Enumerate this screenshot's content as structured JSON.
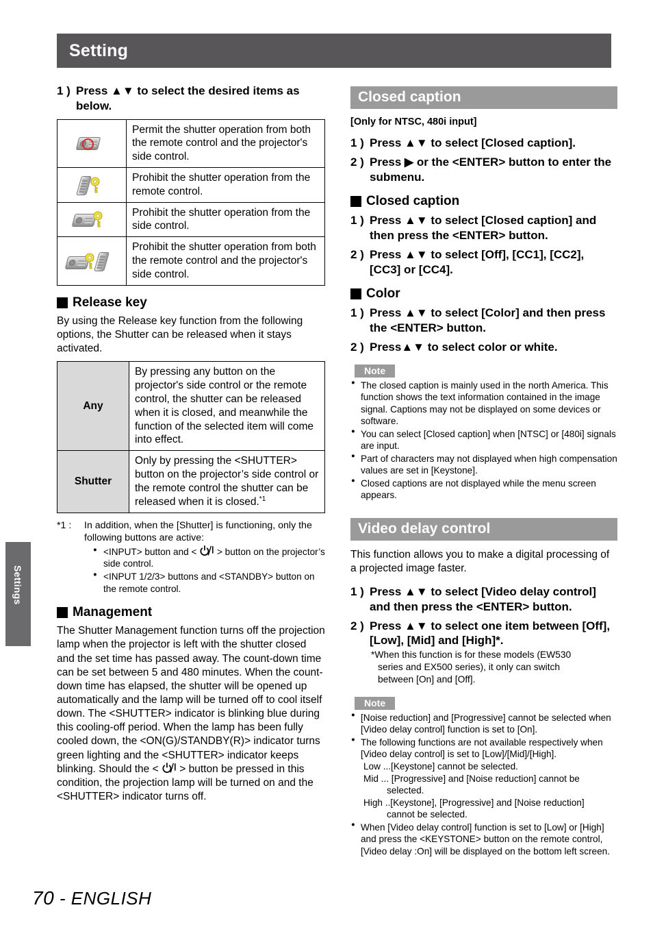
{
  "page": {
    "header_title": "Setting",
    "side_tab": "Settings",
    "footer_page": "70",
    "footer_sep": " - ",
    "footer_lang": "ENGLISH",
    "colors": {
      "header_bar": "#595659",
      "section_bar": "#9b9a9b",
      "side_tab": "#6b6a6c",
      "table_label_fill": "#d9d9d9",
      "icon_red": "#e2231a",
      "icon_yellow": "#f2e33c"
    }
  },
  "left": {
    "step1": {
      "num": "1 )",
      "text": "Press ▲▼ to select the desired items as below."
    },
    "icon_table": [
      {
        "icon": "projector-permit-icon",
        "desc": "Permit the shutter operation from both the remote control and the projector's side control."
      },
      {
        "icon": "remote-prohibit-key-icon",
        "desc": "Prohibit the shutter operation from the remote control."
      },
      {
        "icon": "projector-prohibit-key-icon",
        "desc": "Prohibit the shutter operation from the side control."
      },
      {
        "icon": "projector-remote-prohibit-key-icon",
        "desc": "Prohibit the shutter operation from both the remote control and the projector's side control."
      }
    ],
    "release_key": {
      "heading": "Release key",
      "intro": "By using the Release key function from the following options, the Shutter can be released when it stays activated.",
      "rows": [
        {
          "label": "Any",
          "desc": "By pressing any button on the projector's side control or the remote control, the shutter can be released when it is closed, and meanwhile the function of the selected item will come into effect."
        },
        {
          "label": "Shutter",
          "desc": "Only by pressing the <SHUTTER> button on the projector’s side control or the remote control the shutter can be released when it is closed.",
          "sup": "*1"
        }
      ]
    },
    "footnote": {
      "mark": "*1 :",
      "text": "In addition, when the [Shutter] is functioning, only the following buttons are active:",
      "bullets_pre": "<INPUT> button and < ",
      "bullets_post": " > button on the projector’s side control.",
      "bullet2": "<INPUT 1/2/3> buttons and <STANDBY> button on the remote control."
    },
    "management": {
      "heading": "Management",
      "body": "The Shutter Management function turns off the projection lamp when the projector is left with the shutter closed and the set time has passed away. The count-down time can be set between 5 and 480 minutes. When the count-down time has elapsed, the shutter will be opened up automatically and the lamp will be turned off to cool itself down. The <SHUTTER> indicator is blinking blue during this cooling-off period. When the lamp has been fully cooled down, the <ON(G)/STANDBY(R)> indicator turns green lighting and the <SHUTTER> indicator keeps blinking. Should the < ",
      "body_after": " > button be pressed in this condition, the projection lamp will be turned on and the <SHUTTER> indicator turns off."
    }
  },
  "right": {
    "closed_caption": {
      "bar_title": "Closed caption",
      "applicability": "[Only for NTSC, 480i input]",
      "steps": [
        {
          "num": "1 )",
          "text": "Press ▲▼ to select [Closed caption]."
        },
        {
          "num": "2 )",
          "text": "Press ▶ or the <ENTER> button to enter the submenu."
        }
      ],
      "sub_cc": {
        "heading": "Closed caption",
        "steps": [
          {
            "num": "1 )",
            "text": "Press ▲▼ to select [Closed caption] and then press the <ENTER> button."
          },
          {
            "num": "2 )",
            "text": "Press ▲▼ to select [Off], [CC1], [CC2], [CC3] or [CC4]."
          }
        ]
      },
      "sub_color": {
        "heading": "Color",
        "steps": [
          {
            "num": "1 )",
            "text": "Press ▲▼ to select [Color] and then press the <ENTER> button."
          },
          {
            "num": "2 )",
            "text": "Press▲▼ to select color or white."
          }
        ]
      },
      "note": {
        "badge": "Note",
        "items": [
          "The closed caption is mainly used in the north America. This function shows the text information contained in the image signal. Captions may not be displayed on some devices or software.",
          "You can select [Closed caption] when [NTSC] or [480i] signals are input.",
          "Part of characters may not displayed when high compensation values are set in [Keystone].",
          "Closed captions are not displayed while the menu screen appears."
        ]
      }
    },
    "video_delay": {
      "bar_title": "Video delay control",
      "intro": "This function allows you to make a digital processing of a projected image faster.",
      "steps": [
        {
          "num": "1 )",
          "text": "Press ▲▼ to select [Video delay control] and then press the <ENTER> button."
        },
        {
          "num": "2 )",
          "text": "Press ▲▼ to select one item between [Off], [Low], [Mid] and [High]*."
        }
      ],
      "star_note_1": "*When this function is for these models (EW530",
      "star_note_2": "series and EX500 series), it only can switch",
      "star_note_3": "between [On] and [Off].",
      "note": {
        "badge": "Note",
        "item1": "[Noise reduction] and [Progressive] cannot be selected when [Video delay control] function is set to [On].",
        "item2": "The following functions are not available respectively when [Video delay control] is set to [Low]/[Mid]/[High].",
        "item2_low": "Low ...[Keystone] cannot be selected.",
        "item2_mid": "Mid ... [Progressive] and [Noise reduction] cannot be",
        "item2_mid_cont": "selected.",
        "item2_high": "High ..[Keystone], [Progressive] and [Noise reduction]",
        "item2_high_cont": "cannot be selected.",
        "item3": "When [Video delay control] function is set to [Low] or [High] and press the <KEYSTONE> button on the remote control, [Video delay :On] will be displayed on the bottom left screen."
      }
    }
  }
}
